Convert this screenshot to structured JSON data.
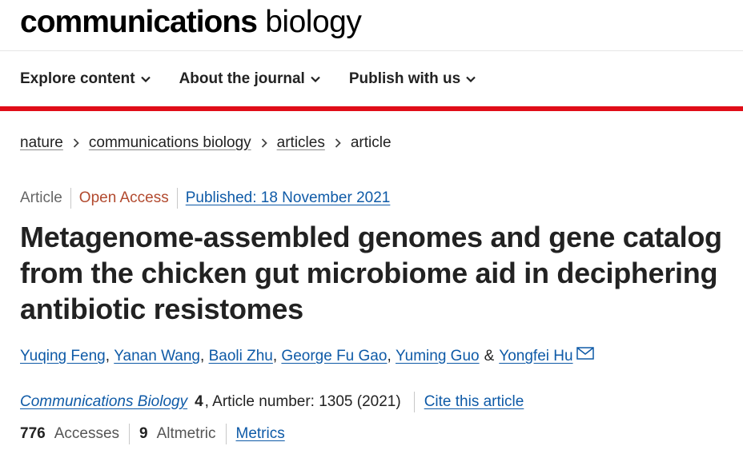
{
  "header": {
    "logo_bold": "communications",
    "logo_light": "biology"
  },
  "nav": {
    "items": [
      {
        "label": "Explore content",
        "icon": "chevron-down-icon"
      },
      {
        "label": "About the journal",
        "icon": "chevron-down-icon"
      },
      {
        "label": "Publish with us",
        "icon": "chevron-down-icon"
      }
    ]
  },
  "colors": {
    "accent_bar": "#e00d18",
    "link": "#0e5aa7",
    "open_access": "#b24a2f"
  },
  "breadcrumb": {
    "items": [
      "nature",
      "communications biology",
      "articles"
    ],
    "current": "article"
  },
  "article_meta": {
    "type": "Article",
    "access": "Open Access",
    "published": "Published: 18 November 2021"
  },
  "title": "Metagenome-assembled genomes and gene catalog from the chicken gut microbiome aid in deciphering antibiotic resistomes",
  "authors": {
    "list": [
      "Yuqing Feng",
      "Yanan Wang",
      "Baoli Zhu",
      "George Fu Gao",
      "Yuming Guo"
    ],
    "last": "Yongfei Hu",
    "separator": ", ",
    "ampersand": "&",
    "corresponding_icon": "mail-icon"
  },
  "citation": {
    "journal": "Communications Biology",
    "volume": "4",
    "article_number": ", Article number: 1305 (2021)",
    "cite_label": "Cite this article"
  },
  "metrics": {
    "accesses_count": "776",
    "accesses_label": "Accesses",
    "altmetric_count": "9",
    "altmetric_label": "Altmetric",
    "metrics_link": "Metrics"
  }
}
